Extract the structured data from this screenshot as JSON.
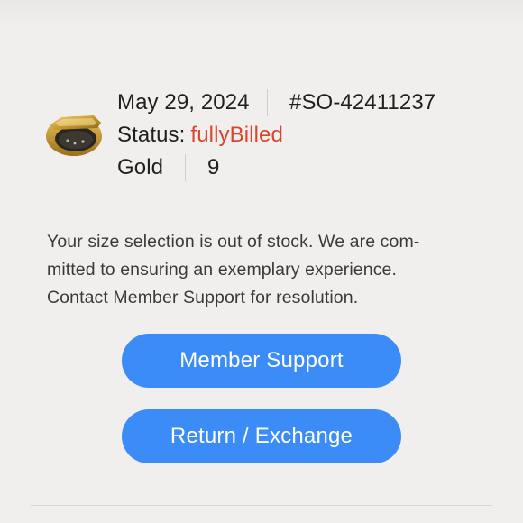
{
  "order": {
    "date": "May 29, 2024",
    "number": "#SO-42411237",
    "status_label": "Status:",
    "status_value": "fullyBilled",
    "color": "Gold",
    "size": "9"
  },
  "product_image": {
    "icon": "gold-ring-icon"
  },
  "message": {
    "line1": "Your size selection is out of stock. We are com-",
    "line2": "mitted to ensuring an exemplary experience.",
    "line3": "Contact Member Support for resolution."
  },
  "actions": {
    "support_label": "Member Support",
    "return_label": "Return / Exchange"
  },
  "colors": {
    "background": "#f0efed",
    "status_red": "#d9452e",
    "button_blue": "#3b8cf6"
  }
}
